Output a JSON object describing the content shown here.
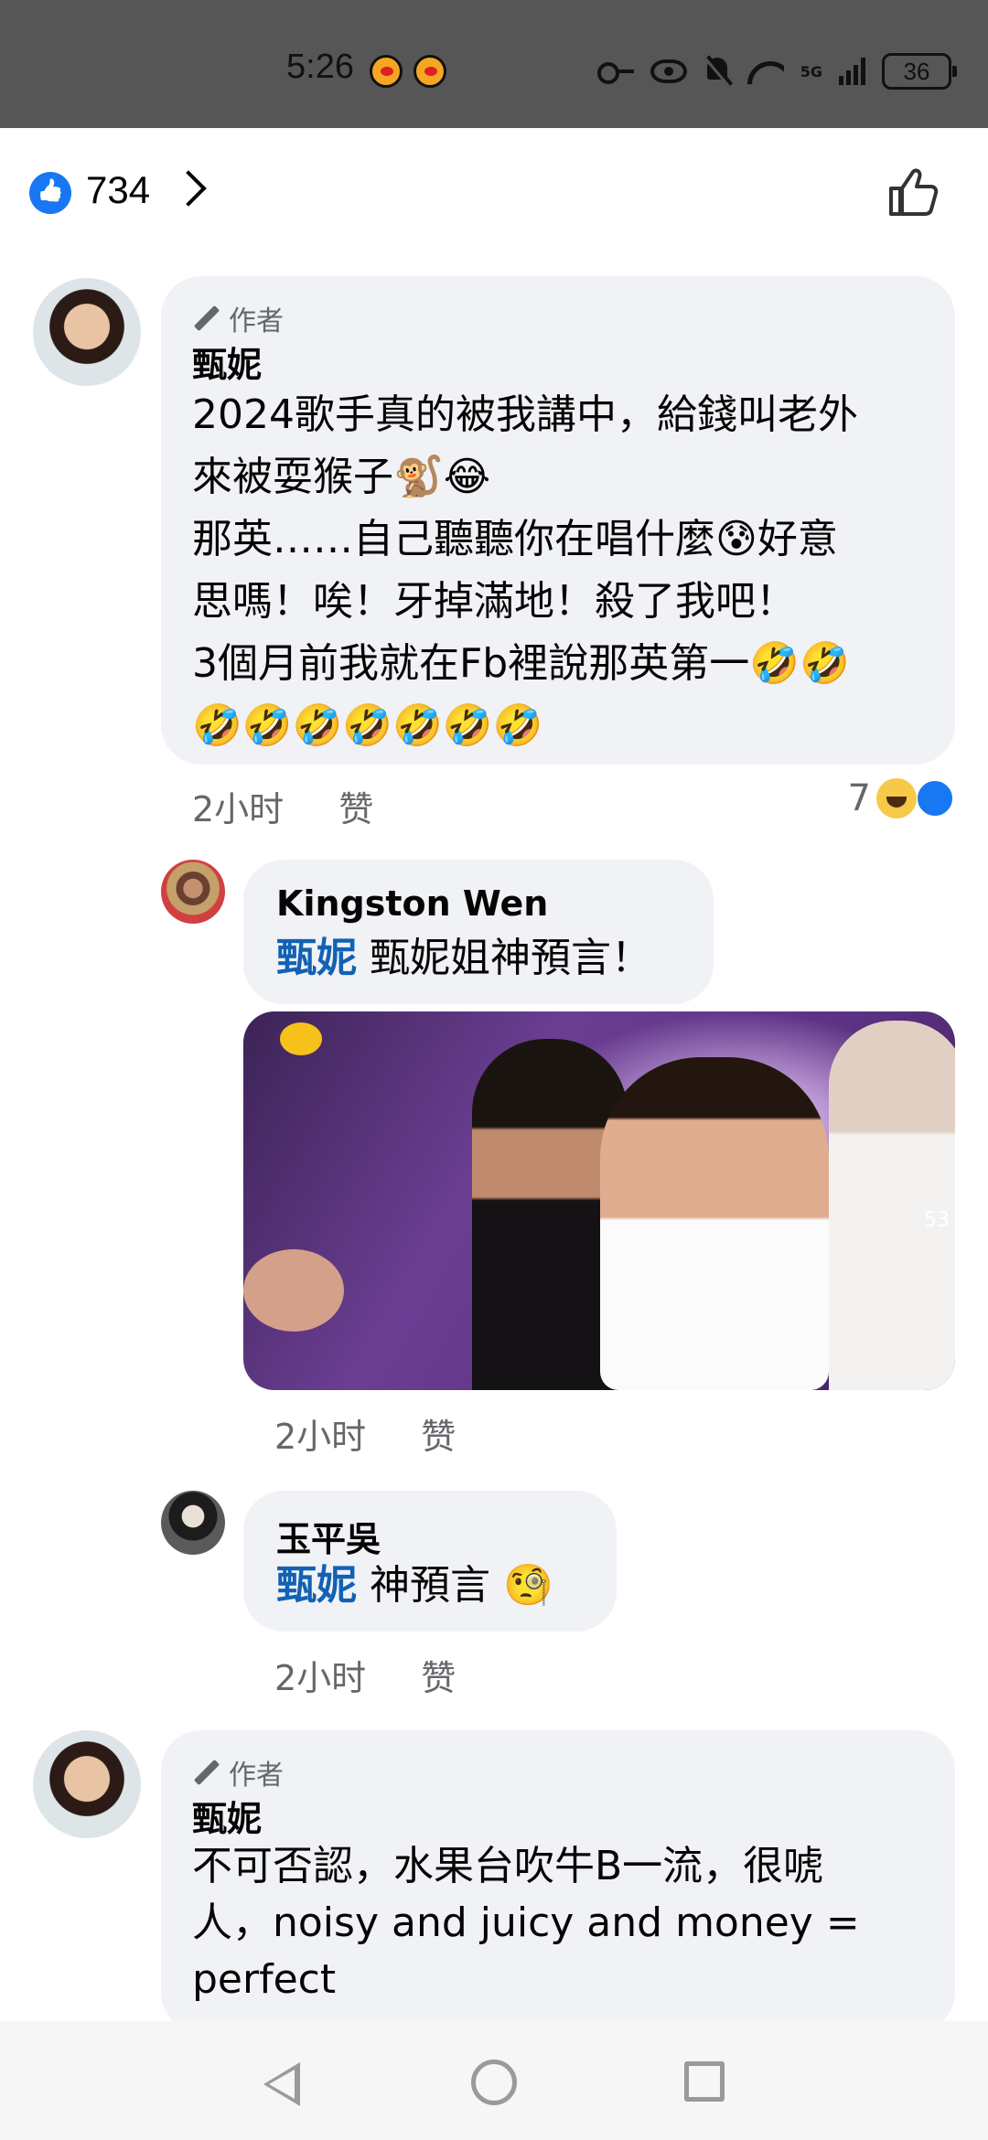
{
  "status_bar": {
    "time": "5:26",
    "signal_label": "5G",
    "battery": "36"
  },
  "reactions": {
    "count": "734"
  },
  "comments": [
    {
      "author_tag": "作者",
      "name": "甄妮",
      "lines": [
        "2024歌手真的被我講中，給錢叫老外",
        "來被耍猴子🐒😂",
        "那英……自己聽聽你在唱什麼😰好意",
        "思嗎！唉！牙掉滿地！殺了我吧！",
        "3個月前我就在Fb裡說那英第一🤣🤣",
        "🤣🤣🤣🤣🤣🤣🤣"
      ],
      "time": "2小时",
      "like_label": "赞",
      "reaction_count": "7"
    },
    {
      "name": "Kingston Wen",
      "mention": "甄妮",
      "text": "甄妮姐神預言！",
      "video_overlay_count": "53",
      "time": "2小时",
      "like_label": "赞"
    },
    {
      "name": "玉平吳",
      "mention": "甄妮",
      "text": "神預言 🧐",
      "time": "2小时",
      "like_label": "赞"
    },
    {
      "author_tag": "作者",
      "name": "甄妮",
      "lines": [
        "不可否認，水果台吹牛B一流，很唬",
        "人，noisy and juicy and money =",
        "perfect"
      ]
    }
  ]
}
